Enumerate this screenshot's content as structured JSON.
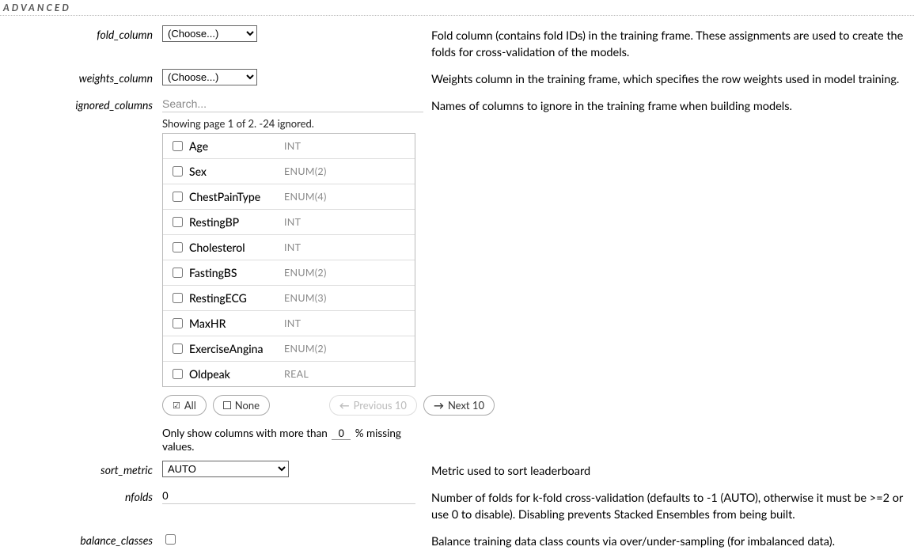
{
  "section_title": "ADVANCED",
  "fields": {
    "fold_column": {
      "label": "fold_column",
      "select_value": "(Choose...)",
      "desc": "Fold column (contains fold IDs) in the training frame. These assignments are used to create the folds for cross-validation of the models."
    },
    "weights_column": {
      "label": "weights_column",
      "select_value": "(Choose...)",
      "desc": "Weights column in the training frame, which specifies the row weights used in model training."
    },
    "ignored_columns": {
      "label": "ignored_columns",
      "search_placeholder": "Search...",
      "paging_msg": "Showing page 1 of 2. -24 ignored.",
      "desc": "Names of columns to ignore in the training frame when building models.",
      "columns": [
        {
          "name": "Age",
          "type": "INT"
        },
        {
          "name": "Sex",
          "type": "ENUM(2)"
        },
        {
          "name": "ChestPainType",
          "type": "ENUM(4)"
        },
        {
          "name": "RestingBP",
          "type": "INT"
        },
        {
          "name": "Cholesterol",
          "type": "INT"
        },
        {
          "name": "FastingBS",
          "type": "ENUM(2)"
        },
        {
          "name": "RestingECG",
          "type": "ENUM(3)"
        },
        {
          "name": "MaxHR",
          "type": "INT"
        },
        {
          "name": "ExerciseAngina",
          "type": "ENUM(2)"
        },
        {
          "name": "Oldpeak",
          "type": "REAL"
        }
      ],
      "all_label": "All",
      "none_label": "None",
      "prev_label": "Previous 10",
      "next_label": "Next 10",
      "filter_prefix": "Only show columns with more than",
      "filter_value": "0",
      "filter_suffix": "% missing values."
    },
    "sort_metric": {
      "label": "sort_metric",
      "select_value": "AUTO",
      "desc": "Metric used to sort leaderboard"
    },
    "nfolds": {
      "label": "nfolds",
      "value": "0",
      "desc": "Number of folds for k-fold cross-validation (defaults to -1 (AUTO), otherwise it must be >=2 or use 0 to disable). Disabling prevents Stacked Ensembles from being built."
    },
    "balance_classes": {
      "label": "balance_classes",
      "checked": false,
      "desc": "Balance training data class counts via over/under-sampling (for imbalanced data)."
    }
  }
}
